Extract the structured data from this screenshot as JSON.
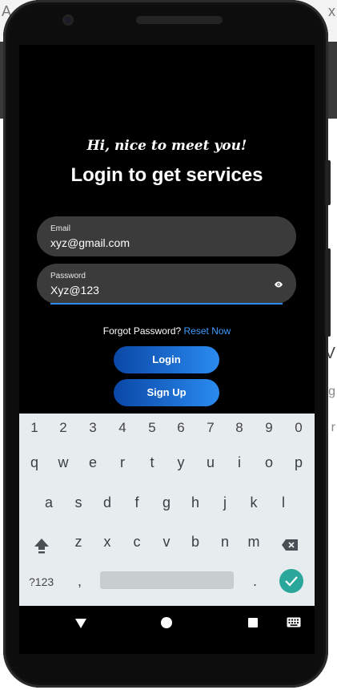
{
  "background": {
    "chars": [
      "A",
      "x",
      "V",
      "g",
      "r"
    ]
  },
  "app": {
    "greeting": "Hi, nice to meet you!",
    "title": "Login to get services",
    "email": {
      "label": "Email",
      "value": "xyz@gmail.com"
    },
    "password": {
      "label": "Password",
      "value": "Xyz@123"
    },
    "forgot": {
      "text": "Forgot Password? ",
      "link": "Reset Now"
    },
    "login_label": "Login",
    "signup_label": "Sign Up",
    "accent_color": "#2d8cf0"
  },
  "keyboard": {
    "numbers": [
      "1",
      "2",
      "3",
      "4",
      "5",
      "6",
      "7",
      "8",
      "9",
      "0"
    ],
    "row1": [
      "q",
      "w",
      "e",
      "r",
      "t",
      "y",
      "u",
      "i",
      "o",
      "p"
    ],
    "row2": [
      "a",
      "s",
      "d",
      "f",
      "g",
      "h",
      "j",
      "k",
      "l"
    ],
    "row3": [
      "z",
      "x",
      "c",
      "v",
      "b",
      "n",
      "m"
    ],
    "symbols_label": "?123",
    "comma": ",",
    "period": ".",
    "enter_color": "#2aa79a"
  }
}
